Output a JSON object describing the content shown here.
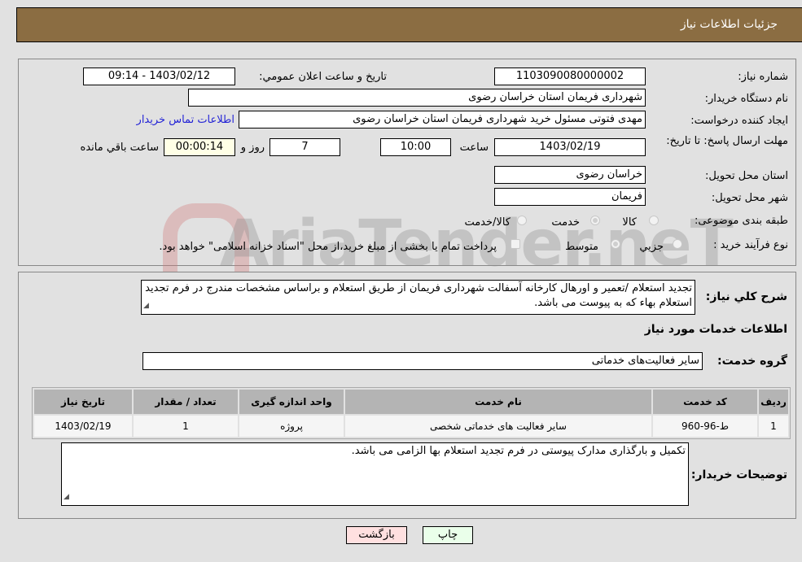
{
  "header": {
    "title": "جزئیات اطلاعات نیاز"
  },
  "form": {
    "need_number": {
      "label": "شماره نیاز:",
      "value": "1103090080000002"
    },
    "announce_datetime": {
      "label": "تاریخ و ساعت اعلان عمومي:",
      "value": "1403/02/12 - 09:14"
    },
    "buyer_org": {
      "label": "نام دستگاه خریدار:",
      "value": "شهرداری فریمان استان خراسان رضوی"
    },
    "requester": {
      "label": "ایجاد کننده درخواست:",
      "value": "مهدی فتوتی مسئول خرید شهرداری فریمان استان خراسان رضوی"
    },
    "buyer_contact_link": "اطلاعات تماس خریدار",
    "deadline": {
      "label": "مهلت ارسال پاسخ: تا تاریخ:",
      "date": "1403/02/19",
      "time_label": "ساعت",
      "time": "10:00",
      "days": "7",
      "days_label": "روز و",
      "remaining": "00:00:14",
      "remaining_label": "ساعت باقي مانده"
    },
    "delivery_province": {
      "label": "استان محل تحویل:",
      "value": "خراسان رضوی"
    },
    "delivery_city": {
      "label": "شهر محل تحویل:",
      "value": "فریمان"
    },
    "category": {
      "label": "طبقه بندی موضوعی:",
      "options": [
        "کالا",
        "خدمت",
        "کالا/خدمت"
      ],
      "selected": "خدمت"
    },
    "purchase_type": {
      "label": "نوع فرآیند خرید :",
      "options": [
        "جزیي",
        "متوسط"
      ],
      "selected": "متوسط",
      "treasury_note": "پرداخت تمام یا بخشی از مبلغ خرید،از محل \"اسناد خزانه اسلامی\" خواهد بود."
    }
  },
  "description": {
    "label": "شرح کلي نياز:",
    "value": "تجدید استعلام /تعمیر و اورهال کارخانه آسفالت شهرداری فریمان از طریق استعلام و براساس مشخصات مندرج در فرم تجدید استعلام بهاء که به پیوست می باشد."
  },
  "services": {
    "section_title": "اطلاعات خدمات مورد نیاز",
    "group_label": "گروه خدمت:",
    "group_value": "سایر فعالیت‌های خدماتی",
    "table": {
      "headers": [
        "ردیف",
        "کد خدمت",
        "نام خدمت",
        "واحد اندازه گیری",
        "تعداد / مقدار",
        "تاریخ نیاز"
      ],
      "rows": [
        [
          "1",
          "ط-96-960",
          "سایر فعالیت های خدماتی شخصی",
          "پروژه",
          "1",
          "1403/02/19"
        ]
      ]
    }
  },
  "buyer_notes": {
    "label": "توضیحات خریدار:",
    "value": "تکمیل و بارگذاری مدارک پیوستی در فرم تجدید استعلام بها الزامی می باشد."
  },
  "buttons": {
    "print": "چاپ",
    "back": "بازگشت"
  },
  "watermark": "AriaTender.neT",
  "colors": {
    "header_bg": "#8b6d42",
    "link": "#2424d6",
    "print_bg": "#eaffea",
    "back_bg": "#ffe0e0"
  }
}
